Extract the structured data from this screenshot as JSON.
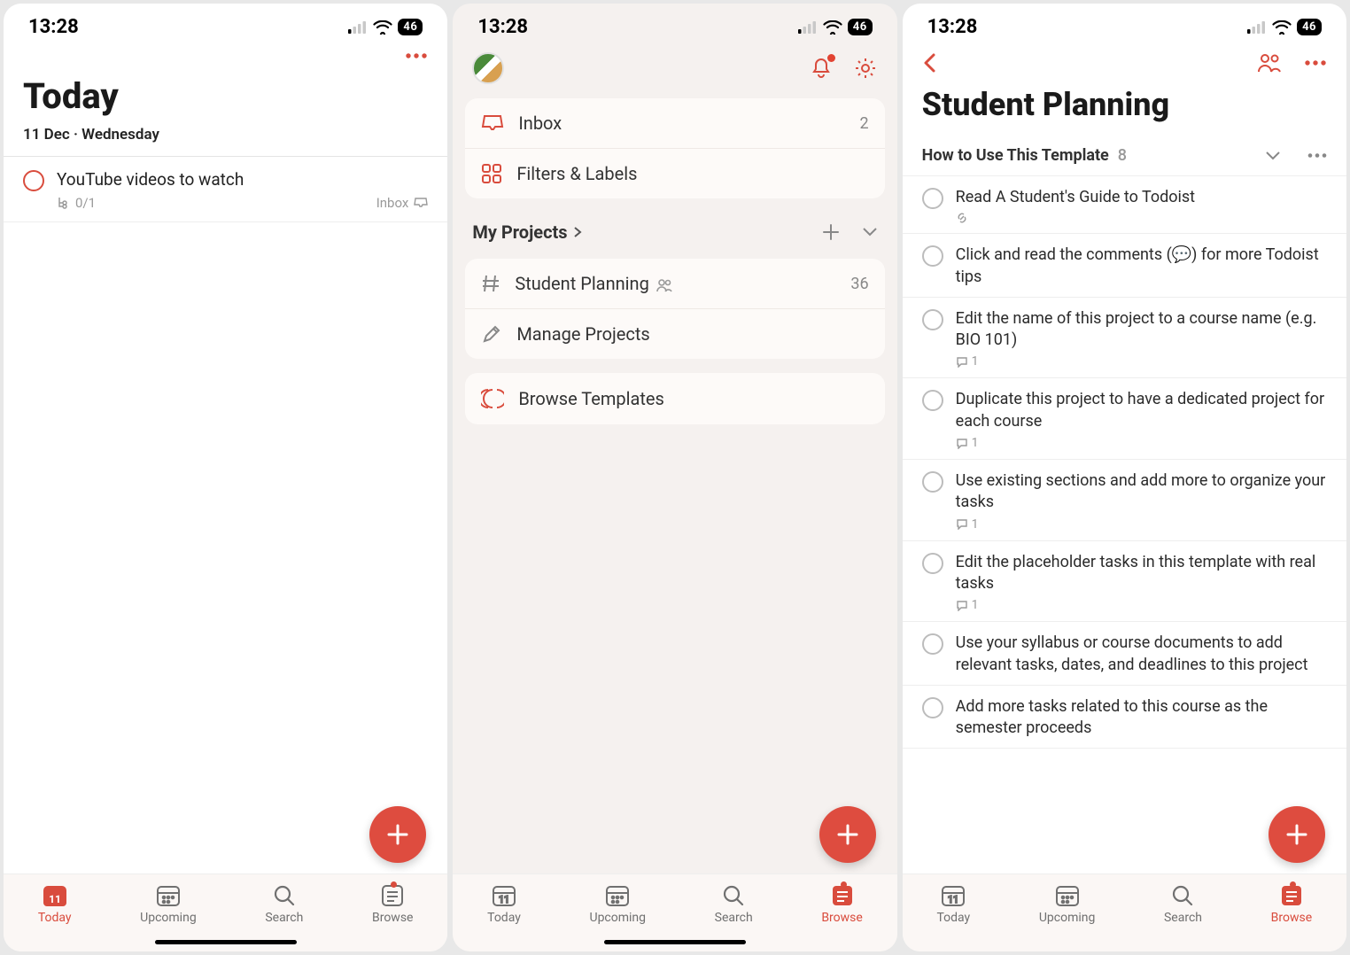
{
  "status": {
    "time": "13:28",
    "battery": "46"
  },
  "screen1": {
    "title": "Today",
    "date": "11 Dec · Wednesday",
    "task": {
      "title": "YouTube videos to watch",
      "subtask_count": "0/1",
      "project": "Inbox"
    }
  },
  "screen2": {
    "inbox_label": "Inbox",
    "inbox_count": "2",
    "filters_label": "Filters & Labels",
    "projects_header": "My Projects",
    "project": {
      "name": "Student Planning",
      "count": "36"
    },
    "manage_label": "Manage Projects",
    "browse_templates": "Browse Templates"
  },
  "screen3": {
    "title": "Student Planning",
    "section": {
      "name": "How to Use This Template",
      "count": "8"
    },
    "tasks": [
      {
        "title": "Read A Student's Guide to Todoist",
        "link": true
      },
      {
        "title": "Click and read the comments (💬) for more Todoist tips"
      },
      {
        "title": "Edit the name of this project to a course name (e.g. BIO 101)",
        "comments": "1"
      },
      {
        "title": "Duplicate this project to have a dedicated project for each course",
        "comments": "1"
      },
      {
        "title": "Use existing sections and add more to organize your tasks",
        "comments": "1"
      },
      {
        "title": "Edit the placeholder tasks in this template with real tasks",
        "comments": "1"
      },
      {
        "title": "Use your syllabus or course documents to add relevant tasks, dates, and deadlines to this project"
      },
      {
        "title": "Add more tasks related to this course as the semester proceeds"
      }
    ]
  },
  "tabs": {
    "today": "Today",
    "upcoming": "Upcoming",
    "search": "Search",
    "browse": "Browse"
  }
}
